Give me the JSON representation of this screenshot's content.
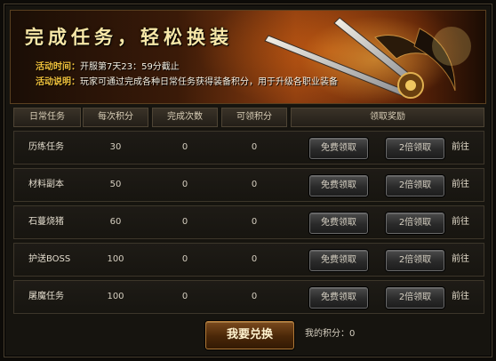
{
  "banner": {
    "title": "完成任务，轻松换装",
    "time_label": "活动时间：",
    "time_value": "开服第7天23：59分截止",
    "desc_label": "活动说明：",
    "desc_value": "玩家可通过完成各种日常任务获得装备积分，用于升级各职业装备"
  },
  "table": {
    "headers": [
      "日常任务",
      "每次积分",
      "完成次数",
      "可领积分",
      "领取奖励"
    ],
    "rows": [
      {
        "name": "历练任务",
        "per": "30",
        "done": "0",
        "claimable": "0"
      },
      {
        "name": "材料副本",
        "per": "50",
        "done": "0",
        "claimable": "0"
      },
      {
        "name": "石蔓烧猪",
        "per": "60",
        "done": "0",
        "claimable": "0"
      },
      {
        "name": "护送BOSS",
        "per": "100",
        "done": "0",
        "claimable": "0"
      },
      {
        "name": "屠魔任务",
        "per": "100",
        "done": "0",
        "claimable": "0"
      }
    ],
    "free_claim_label": "免费领取",
    "double_claim_label": "2倍领取",
    "goto_label": "前往"
  },
  "footer": {
    "exchange_label": "我要兑换",
    "points_text": "我的积分：0"
  }
}
